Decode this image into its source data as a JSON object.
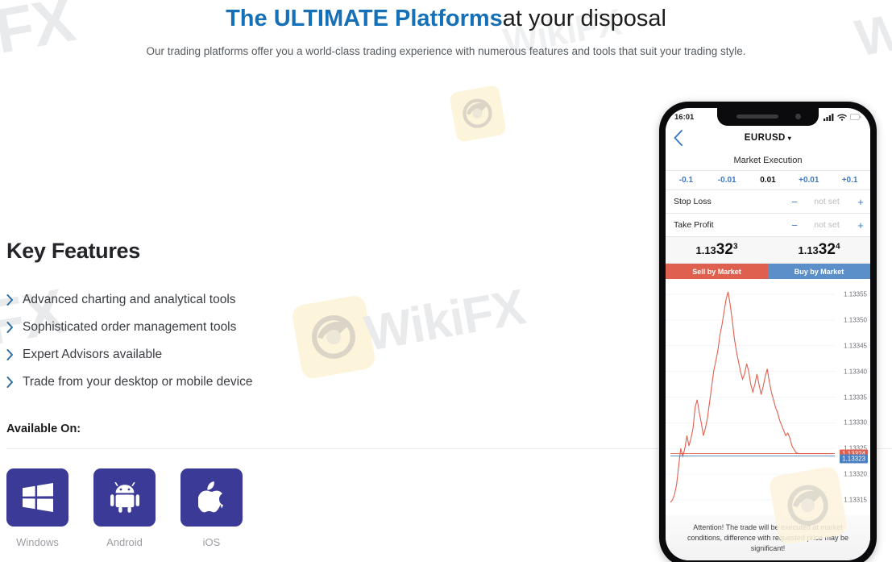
{
  "hero": {
    "title_blue": "The ULTIMATE Platforms",
    "title_dark": "at your disposal",
    "subtitle": "Our trading platforms offer you a world-class trading experience with numerous features and tools that suit your trading style."
  },
  "features": {
    "heading": "Key Features",
    "items": [
      "Advanced charting and analytical tools",
      "Sophisticated order management tools",
      "Expert Advisors available",
      "Trade from your desktop or mobile device"
    ]
  },
  "available": {
    "heading": "Available On:",
    "platforms": [
      {
        "label": "Windows",
        "icon": "windows-icon"
      },
      {
        "label": "Android",
        "icon": "android-icon"
      },
      {
        "label": "iOS",
        "icon": "apple-icon"
      }
    ]
  },
  "phone": {
    "status": {
      "time": "16:01",
      "signal_icon": "signal-bars-icon",
      "wifi_icon": "wifi-icon",
      "battery_icon": "battery-icon"
    },
    "nav": {
      "back_icon": "chevron-left-icon",
      "symbol": "EURUSD",
      "caret": "▾"
    },
    "execution_mode": "Market Execution",
    "volume_steps": [
      "-0.1",
      "-0.01",
      "0.01",
      "+0.01",
      "+0.1"
    ],
    "orders": [
      {
        "label": "Stop Loss",
        "minus": "−",
        "value": "not set",
        "plus": "+"
      },
      {
        "label": "Take Profit",
        "minus": "−",
        "value": "not set",
        "plus": "+"
      }
    ],
    "prices": [
      {
        "big_prefix": "1.13",
        "big": "32",
        "sup": "3"
      },
      {
        "big_prefix": "1.13",
        "big": "32",
        "sup": "4"
      }
    ],
    "buttons": {
      "sell": "Sell by Market",
      "buy": "Buy by Market"
    },
    "disclaimer": "Attention! The trade will be executed at market conditions, difference with requested price may be significant!"
  },
  "chart_data": {
    "type": "line",
    "title": "",
    "xlabel": "",
    "ylabel": "",
    "ylim": [
      1.13312,
      1.13358
    ],
    "grid": true,
    "legend": null,
    "axis_ticks": [
      "1.13355",
      "1.13350",
      "1.13345",
      "1.13340",
      "1.13335",
      "1.13330",
      "1.13325",
      "1.13320",
      "1.13315"
    ],
    "price_tags": [
      {
        "value": "1.13324",
        "color": "#e0604f",
        "kind": "bid"
      },
      {
        "value": "1.13323",
        "color": "#4a7fc1",
        "kind": "ask"
      }
    ],
    "line_color": "#e0604f",
    "series": [
      {
        "name": "EURUSD",
        "values": [
          1.133145,
          1.13315,
          1.13316,
          1.13318,
          1.133215,
          1.13325,
          1.133235,
          1.13325,
          1.133275,
          1.133255,
          1.13327,
          1.13329,
          1.13333,
          1.133345,
          1.13332,
          1.1333,
          1.133275,
          1.13329,
          1.13331,
          1.13334,
          1.13337,
          1.1334,
          1.13342,
          1.13344,
          1.13347,
          1.13349,
          1.133515,
          1.13354,
          1.133555,
          1.13353,
          1.1335,
          1.133465,
          1.13344,
          1.13342,
          1.1334,
          1.133385,
          1.133395,
          1.133415,
          1.1334,
          1.133375,
          1.13336,
          1.133375,
          1.133395,
          1.133375,
          1.133355,
          1.13337,
          1.13339,
          1.133405,
          1.13338,
          1.13336,
          1.133345,
          1.13333,
          1.13332,
          1.133305,
          1.133295,
          1.133285,
          1.133275,
          1.13328,
          1.13327,
          1.133255,
          1.133248,
          1.133242,
          1.13324,
          1.13324,
          1.13324,
          1.13324,
          1.13324,
          1.13324,
          1.13324,
          1.13324,
          1.13324,
          1.13324,
          1.13324,
          1.13324,
          1.13324,
          1.13324,
          1.13324,
          1.13324,
          1.13324,
          1.13324
        ]
      }
    ]
  },
  "watermark": {
    "brand": "WikiFX",
    "fx": "FX",
    "w": "W"
  },
  "colors": {
    "accent_blue": "#1570b8",
    "chevron_blue": "#2e6da4",
    "tile_indigo": "#3b3a96",
    "sell_red": "#e0604f",
    "buy_blue": "#5b8fc9",
    "ios_link_blue": "#3a78c9"
  }
}
